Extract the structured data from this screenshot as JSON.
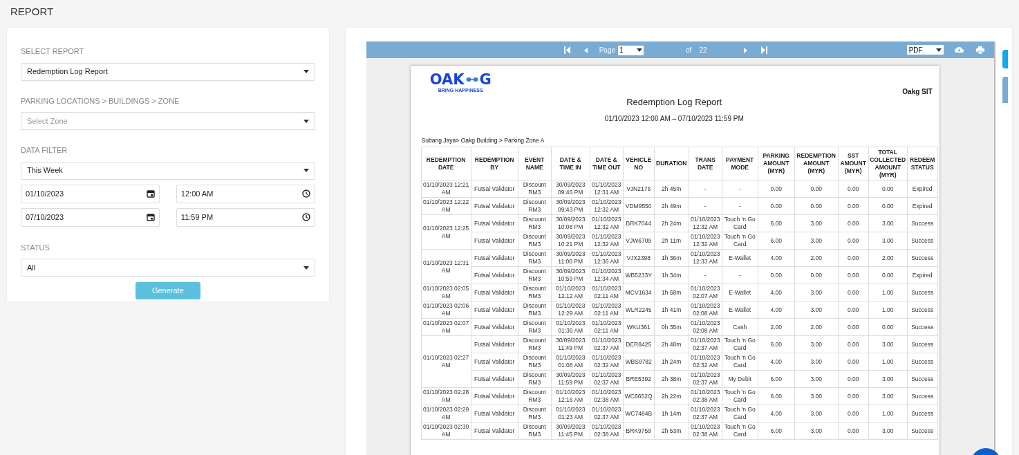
{
  "page_title": "REPORT",
  "form": {
    "select_report": {
      "label": "SELECT REPORT",
      "value": "Redemption Log Report"
    },
    "zone": {
      "label": "PARKING LOCATIONS > BUILDINGS > ZONE",
      "placeholder": "Select Zone"
    },
    "data_filter": {
      "label": "DATA FILTER",
      "value": "This Week",
      "from_date": "01/10/2023",
      "from_time": "12:00 AM",
      "to_date": "07/10/2023",
      "to_time": "11:59 PM"
    },
    "status": {
      "label": "STATUS",
      "value": "All"
    },
    "generate_button": "Generate"
  },
  "viewer": {
    "toolbar": {
      "page_label": "Page",
      "page": "1",
      "of_label": "of",
      "total_pages": "22",
      "format": "PDF"
    },
    "report": {
      "logo_left": "OAK",
      "logo_right": "G",
      "logo_tagline": "BRING HAPPINESS",
      "company": "Oakg SIT",
      "title": "Redemption Log Report",
      "period": "01/10/2023 12:00 AM – 07/10/2023 11:59 PM",
      "location": "Subang Jaya> Oakg Building > Parking Zone A",
      "columns": [
        "REDEMPTION DATE",
        "REDEMPTION BY",
        "EVENT NAME",
        "DATE & TIME IN",
        "DATE & TIME OUT",
        "VEHICLE NO",
        "DURATION",
        "TRANS DATE",
        "PAYMENT MODE",
        "PARKING AMOUNT (MYR)",
        "REDEMPTION AMOUNT (MYR)",
        "SST AMOUNT (MYR)",
        "TOTAL COLLECTED AMOUNT (MYR)",
        "REDEEM STATUS"
      ],
      "groups": [
        {
          "redemption_date": "01/10/2023 12:21 AM",
          "entries": [
            [
              "Futsal Validator",
              "Discount RM3",
              "30/09/2023 09:46 PM",
              "01/10/2023 12:31 AM",
              "VJN2176",
              "2h 45m",
              "-",
              "-",
              "0.00",
              "0.00",
              "0.00",
              "0.00",
              "Expired"
            ]
          ]
        },
        {
          "redemption_date": "01/10/2023 12:22 AM",
          "entries": [
            [
              "Futsal Validator",
              "Discount RM3",
              "30/09/2023 09:43 PM",
              "01/10/2023 12:32 AM",
              "VDM9550",
              "2h 49m",
              "-",
              "-",
              "0.00",
              "0.00",
              "0.00",
              "0.00",
              "Expired"
            ]
          ]
        },
        {
          "redemption_date": "01/10/2023 12:25 AM",
          "entries": [
            [
              "Futsal Validator",
              "Discount RM3",
              "30/09/2023 10:08 PM",
              "01/10/2023 12:32 AM",
              "BRK7044",
              "2h 24m",
              "01/10/2023 12:32 AM",
              "Touch 'n Go Card",
              "6.00",
              "3.00",
              "0.00",
              "3.00",
              "Success"
            ],
            [
              "Futsal Validator",
              "Discount RM3",
              "30/09/2023 10:21 PM",
              "01/10/2023 12:32 AM",
              "VJW6709",
              "2h 11m",
              "01/10/2023 12:32 AM",
              "Touch 'n Go Card",
              "6.00",
              "3.00",
              "0.00",
              "3.00",
              "Success"
            ]
          ]
        },
        {
          "redemption_date": "01/10/2023 12:31 AM",
          "entries": [
            [
              "Futsal Validator",
              "Discount RM3",
              "30/09/2023 11:00 PM",
              "01/10/2023 12:36 AM",
              "VJX2398",
              "1h 36m",
              "01/10/2023 12:33 AM",
              "E-Wallet",
              "4.00",
              "2.00",
              "0.00",
              "2.00",
              "Success"
            ],
            [
              "Futsal Validator",
              "Discount RM3",
              "30/09/2023 10:59 PM",
              "01/10/2023 12:34 AM",
              "WB5233Y",
              "1h 34m",
              "-",
              "-",
              "0.00",
              "0.00",
              "0.00",
              "0.00",
              "Expired"
            ]
          ]
        },
        {
          "redemption_date": "01/10/2023 02:05 AM",
          "entries": [
            [
              "Futsal Validator",
              "Discount RM3",
              "01/10/2023 12:12 AM",
              "01/10/2023 02:11 AM",
              "MCV1634",
              "1h 58m",
              "01/10/2023 02:07 AM",
              "E-Wallet",
              "4.00",
              "3.00",
              "0.00",
              "1.00",
              "Success"
            ]
          ]
        },
        {
          "redemption_date": "01/10/2023 02:06 AM",
          "entries": [
            [
              "Futsal Validator",
              "Discount RM3",
              "01/10/2023 12:29 AM",
              "01/10/2023 02:11 AM",
              "WLR2245",
              "1h 41m",
              "01/10/2023 02:08 AM",
              "E-Wallet",
              "4.00",
              "3.00",
              "0.00",
              "1.00",
              "Success"
            ]
          ]
        },
        {
          "redemption_date": "01/10/2023 02:07 AM",
          "entries": [
            [
              "Futsal Validator",
              "Discount RM3",
              "01/10/2023 01:36 AM",
              "01/10/2023 02:11 AM",
              "WKU361",
              "0h 35m",
              "01/10/2023 02:08 AM",
              "Cash",
              "2.00",
              "2.00",
              "0.00",
              "0.00",
              "Success"
            ]
          ]
        },
        {
          "redemption_date": "01/10/2023 02:27 AM",
          "entries": [
            [
              "Futsal Validator",
              "Discount RM3",
              "30/09/2023 11:49 PM",
              "01/10/2023 02:37 AM",
              "DER8425",
              "2h 48m",
              "01/10/2023 02:37 AM",
              "Touch 'n Go Card",
              "6.00",
              "3.00",
              "0.00",
              "3.00",
              "Success"
            ],
            [
              "Futsal Validator",
              "Discount RM3",
              "01/10/2023 01:08 AM",
              "01/10/2023 02:32 AM",
              "WBS9782",
              "1h 24m",
              "01/10/2023 02:32 AM",
              "Touch 'n Go Card",
              "4.00",
              "3.00",
              "0.00",
              "1.00",
              "Success"
            ],
            [
              "Futsal Validator",
              "Discount RM3",
              "30/09/2023 11:59 PM",
              "01/10/2023 02:37 AM",
              "BRE5392",
              "2h 38m",
              "01/10/2023 02:37 AM",
              "My Debit",
              "6.00",
              "3.00",
              "0.00",
              "3.00",
              "Success"
            ]
          ]
        },
        {
          "redemption_date": "01/10/2023 02:28 AM",
          "entries": [
            [
              "Futsal Validator",
              "Discount RM3",
              "01/10/2023 12:16 AM",
              "01/10/2023 02:38 AM",
              "WC6652Q",
              "2h 22m",
              "01/10/2023 02:38 AM",
              "Touch 'n Go Card",
              "6.00",
              "3.00",
              "0.00",
              "3.00",
              "Success"
            ]
          ]
        },
        {
          "redemption_date": "01/10/2023 02:29 AM",
          "entries": [
            [
              "Futsal Validator",
              "Discount RM3",
              "01/10/2023 01:23 AM",
              "01/10/2023 02:37 AM",
              "WC7484B",
              "1h 14m",
              "01/10/2023 02:37 AM",
              "Touch 'n Go Card",
              "4.00",
              "3.00",
              "0.00",
              "1.00",
              "Success"
            ]
          ]
        },
        {
          "redemption_date": "01/10/2023 02:30 AM",
          "entries": [
            [
              "Futsal Validator",
              "Discount RM3",
              "30/09/2023 11:45 PM",
              "01/10/2023 02:38 AM",
              "BRK9759",
              "2h 53m",
              "01/10/2023 02:38 AM",
              "Touch 'n Go Card",
              "6.00",
              "3.00",
              "0.00",
              "3.00",
              "Success"
            ]
          ]
        }
      ]
    }
  }
}
